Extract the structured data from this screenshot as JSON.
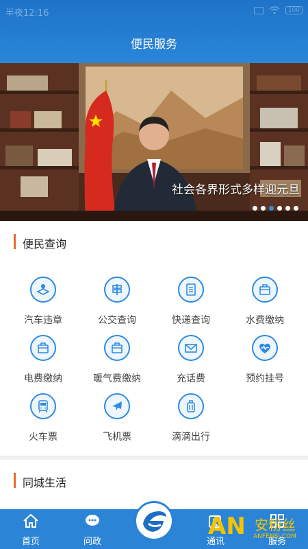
{
  "status": {
    "time": "半夜12:16",
    "battery": "100"
  },
  "header": {
    "title": "便民服务"
  },
  "banner": {
    "caption": "社会各界形式多样迎元旦",
    "dot_count": 6,
    "active_dot": 2
  },
  "sections": [
    {
      "title": "便民查询"
    },
    {
      "title": "同城生活"
    }
  ],
  "services": [
    {
      "label": "汽车违章",
      "icon": "car-map-icon"
    },
    {
      "label": "公交查询",
      "icon": "bus-sign-icon"
    },
    {
      "label": "快递查询",
      "icon": "document-icon"
    },
    {
      "label": "水费缴纳",
      "icon": "bag-icon"
    },
    {
      "label": "电费缴纳",
      "icon": "bag-icon"
    },
    {
      "label": "暖气费缴纳",
      "icon": "bag-icon"
    },
    {
      "label": "充话费",
      "icon": "envelope-icon"
    },
    {
      "label": "预约挂号",
      "icon": "heart-pulse-icon"
    },
    {
      "label": "火车票",
      "icon": "train-icon"
    },
    {
      "label": "飞机票",
      "icon": "airplane-icon"
    },
    {
      "label": "滴滴出行",
      "icon": "luggage-icon"
    }
  ],
  "tabs": [
    {
      "label": "首页",
      "icon": "home-icon"
    },
    {
      "label": "问政",
      "icon": "chat-icon"
    },
    {
      "label": "",
      "icon": "app-logo"
    },
    {
      "label": "通讯",
      "icon": "contacts-icon"
    },
    {
      "label": "服务",
      "icon": "grid-icon"
    }
  ],
  "watermark": {
    "brand": "AN",
    "name": "安粉丝",
    "url": "ANFENSI.COM"
  },
  "colors": {
    "primary": "#2b84d6",
    "accent": "#e86a2c",
    "icon": "#2d8ae0"
  }
}
